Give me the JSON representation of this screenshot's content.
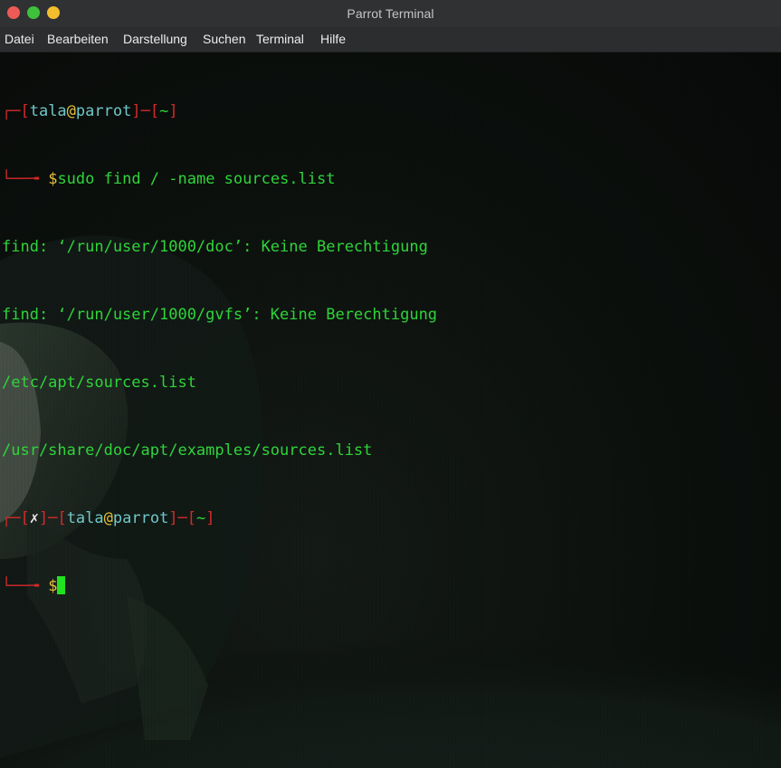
{
  "window": {
    "title": "Parrot Terminal"
  },
  "menu": {
    "items": [
      "Datei",
      "Bearbeiten",
      "Darstellung",
      "Suchen",
      "Terminal",
      "Hilfe"
    ]
  },
  "prompt1": {
    "corner_top": "┌─[",
    "user": "tala",
    "at": "@",
    "host": "parrot",
    "sep": "]─[",
    "dir": "~",
    "close": "]",
    "corner_bottom": "└──╼ ",
    "dollar": "$",
    "command": "sudo find / -name sources.list"
  },
  "output": [
    "find: ‘/run/user/1000/doc’: Keine Berechtigung",
    "find: ‘/run/user/1000/gvfs’: Keine Berechtigung",
    "/etc/apt/sources.list",
    "/usr/share/doc/apt/examples/sources.list"
  ],
  "prompt2": {
    "corner_top": "┌─[",
    "status": "✗",
    "sep1": "]─[",
    "user": "tala",
    "at": "@",
    "host": "parrot",
    "sep2": "]─[",
    "dir": "~",
    "close": "]",
    "corner_bottom": "└──╼ ",
    "dollar": "$"
  },
  "colors": {
    "prompt_frame": "#d32a2a",
    "user_host": "#6fc7c7",
    "at_dollar": "#e6c13c",
    "text": "#2fd43a",
    "cursor": "#22e11f"
  }
}
